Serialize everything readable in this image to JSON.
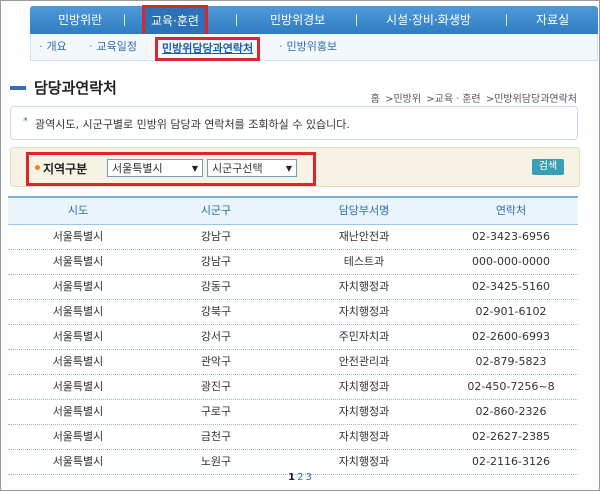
{
  "topnav": {
    "items": [
      "민방위란",
      "교육·훈련",
      "민방위경보",
      "시설·장비·화생방",
      "자료실"
    ]
  },
  "subnav": {
    "items": [
      "개요",
      "교육일정",
      "민방위담당과연락처",
      "민방위홍보"
    ]
  },
  "page_title": "담당과연락처",
  "breadcrumb": [
    "홈",
    ">민방위",
    ">교육ㆍ훈련",
    ">민방위담당과연락처"
  ],
  "notice": {
    "marker": "*",
    "text": "광역시도, 시군구별로 민방위 담당과 연락처를 조회하실 수 있습니다."
  },
  "search": {
    "label": "지역구분",
    "sido_value": "서울특별시",
    "sigungu_value": "시군구선택",
    "button_label": "검색"
  },
  "table": {
    "headers": [
      "시도",
      "시군구",
      "담당부서명",
      "연락처"
    ],
    "rows": [
      [
        "서울특별시",
        "강남구",
        "재난안전과",
        "02-3423-6956"
      ],
      [
        "서울특별시",
        "강남구",
        "테스트과",
        "000-000-0000"
      ],
      [
        "서울특별시",
        "강동구",
        "자치행정과",
        "02-3425-5160"
      ],
      [
        "서울특별시",
        "강북구",
        "자치행정과",
        "02-901-6102"
      ],
      [
        "서울특별시",
        "강서구",
        "주민자치과",
        "02-2600-6993"
      ],
      [
        "서울특별시",
        "관악구",
        "안전관리과",
        "02-879-5823"
      ],
      [
        "서울특별시",
        "광진구",
        "자치행정과",
        "02-450-7256~8"
      ],
      [
        "서울특별시",
        "구로구",
        "자치행정과",
        "02-860-2326"
      ],
      [
        "서울특별시",
        "금천구",
        "자치행정과",
        "02-2627-2385"
      ],
      [
        "서울특별시",
        "노원구",
        "자치행정과",
        "02-2116-3126"
      ]
    ]
  },
  "pager": {
    "current": "1",
    "pages": [
      "2",
      "3"
    ]
  }
}
